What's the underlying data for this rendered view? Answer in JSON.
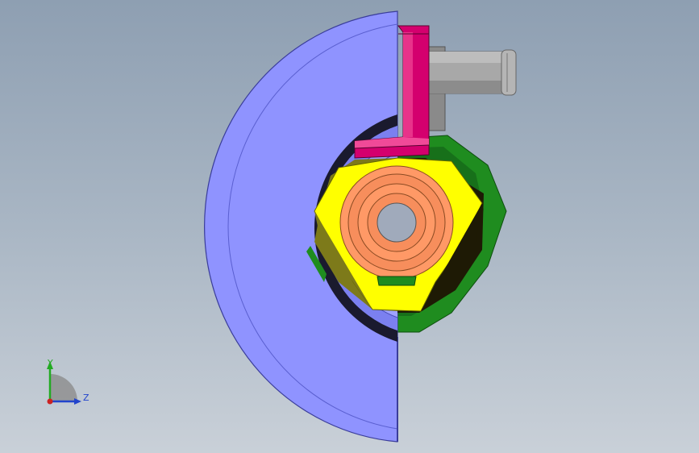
{
  "viewport": {
    "background_top": "#8e9fb2",
    "background_bottom": "#c9d0d8"
  },
  "model": {
    "parts": [
      {
        "name": "outer-half-disc",
        "color": "#8f93ff"
      },
      {
        "name": "pink-bracket",
        "color": "#d4006e"
      },
      {
        "name": "grey-shaft",
        "color": "#a3a3a3"
      },
      {
        "name": "green-cam",
        "color": "#1f8c1f"
      },
      {
        "name": "yellow-triangle-cam",
        "color": "#ffff00"
      },
      {
        "name": "orange-hub",
        "color": "#ff9966"
      },
      {
        "name": "black-groove",
        "color": "#1a1a2e"
      }
    ]
  },
  "triad": {
    "y_label": "Y",
    "z_label": "Z",
    "y_color": "#22aa22",
    "z_color": "#2244cc",
    "x_color": "#cc2222"
  }
}
